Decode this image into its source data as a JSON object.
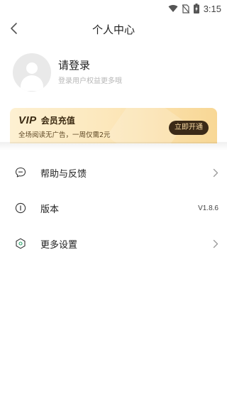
{
  "status_bar": {
    "time": "3:15",
    "icons": [
      "wifi-icon",
      "no-sim-icon",
      "battery-charging-icon"
    ]
  },
  "header": {
    "title": "个人中心",
    "back_icon": "chevron-left-icon"
  },
  "profile": {
    "avatar_icon": "default-avatar-icon",
    "login_label": "请登录",
    "login_sub": "登录用户权益更多哦"
  },
  "vip": {
    "logo": "VIP",
    "title": "会员充值",
    "description": "全场阅读无广告，一周仅需2元",
    "button_label": "立即开通",
    "colors": {
      "card_start": "#fdf0d2",
      "card_end": "#f8d795",
      "button_bg": "#3b2a17",
      "button_text": "#f7d9a3"
    }
  },
  "menu": {
    "items": [
      {
        "label": "帮助与反馈",
        "icon": "chat-bubble-icon",
        "value": "",
        "has_chevron": true
      },
      {
        "label": "版本",
        "icon": "info-icon",
        "value": "V1.8.6",
        "has_chevron": false
      },
      {
        "label": "更多设置",
        "icon": "settings-hexagon-icon",
        "value": "",
        "has_chevron": true
      }
    ]
  }
}
